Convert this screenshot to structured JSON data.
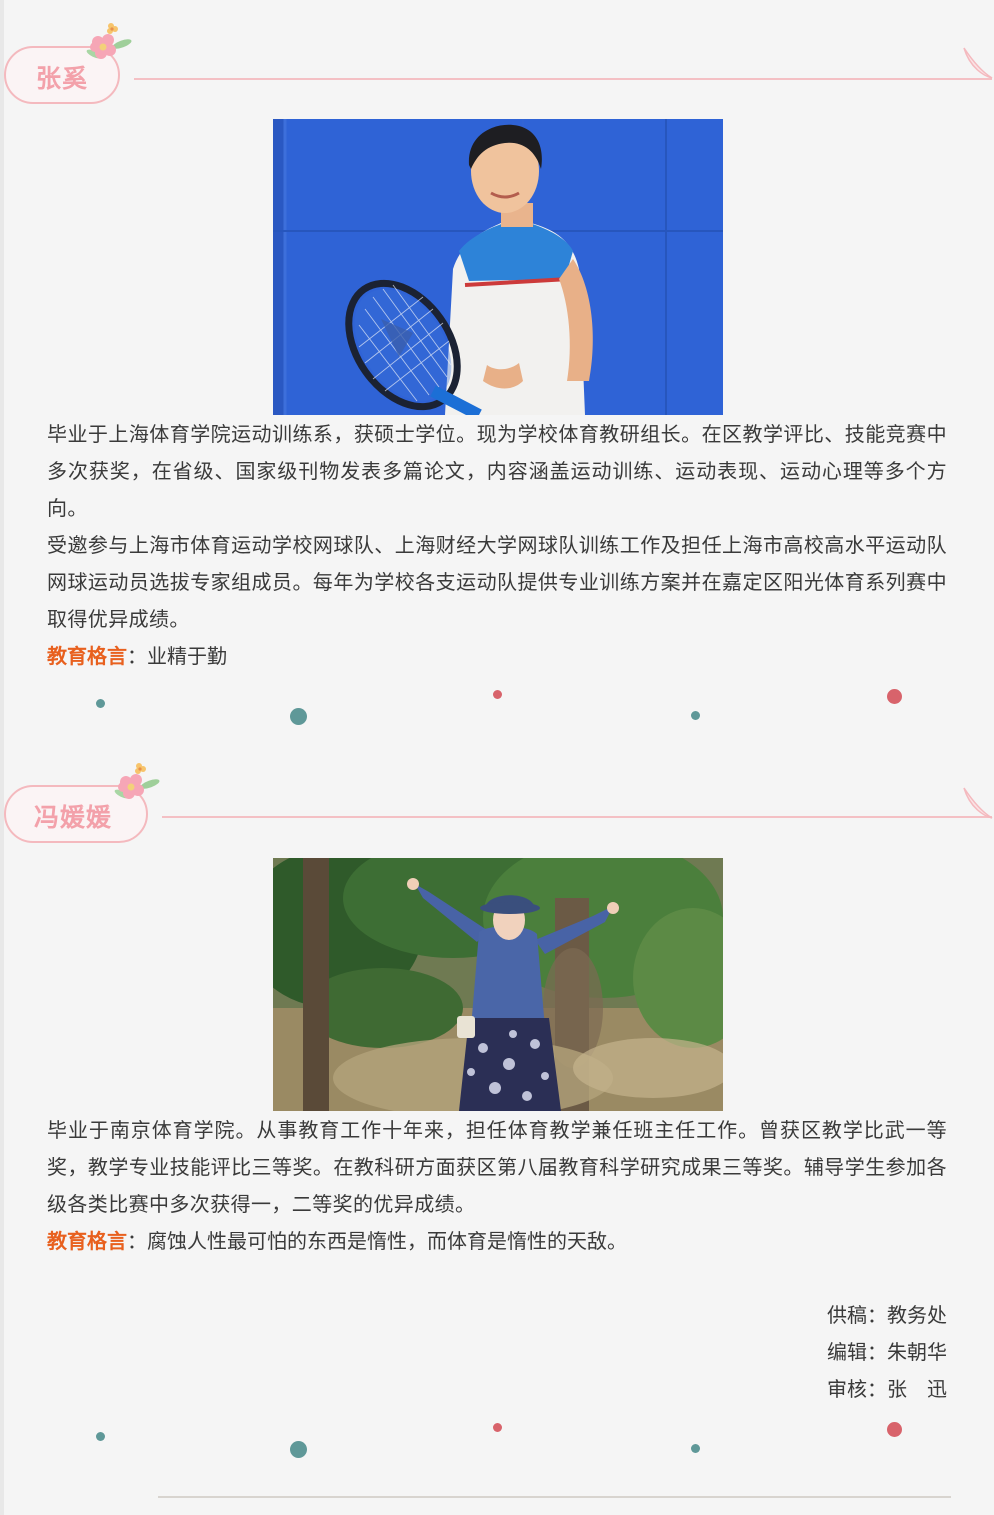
{
  "profiles": [
    {
      "name": "张奚",
      "photo_alt": "张奚",
      "paragraphs": [
        "毕业于上海体育学院运动训练系，获硕士学位。现为学校体育教研组长。在区教学评比、技能竞赛中多次获奖，在省级、国家级刊物发表多篇论文，内容涵盖运动训练、运动表现、运动心理等多个方向。",
        "受邀参与上海市体育运动学校网球队、上海财经大学网球队训练工作及担任上海市高校高水平运动队网球运动员选拔专家组成员。每年为学校各支运动队提供专业训练方案并在嘉定区阳光体育系列赛中取得优异成绩。"
      ],
      "motto_label": "教育格言",
      "motto_sep": "：",
      "motto_text": "业精于勤"
    },
    {
      "name": "冯媛媛",
      "photo_alt": "冯媛媛",
      "paragraphs": [
        "毕业于南京体育学院。从事教育工作十年来，担任体育教学兼任班主任工作。曾获区教学比武一等奖，教学专业技能评比三等奖。在教科研方面获区第八届教育科学研究成果三等奖。辅导学生参加各级各类比赛中多次获得一，二等奖的优异成绩。"
      ],
      "motto_label": "教育格言",
      "motto_sep": "：",
      "motto_text": "腐蚀人性最可怕的东西是惰性，而体育是惰性的天敌。"
    }
  ],
  "credits": {
    "source": "供稿：教务处",
    "editor": "编辑：朱朝华",
    "reviewer": "审核：张　迅"
  },
  "colors": {
    "tag_border": "#f4b9be",
    "tag_text": "#f3a1aa",
    "motto_label": "#e8601e",
    "dot_teal": "#5f9898",
    "dot_red": "#d8636b"
  },
  "icons": [
    "flower-icon",
    "petal-leaf-icon",
    "decorative-dot"
  ]
}
